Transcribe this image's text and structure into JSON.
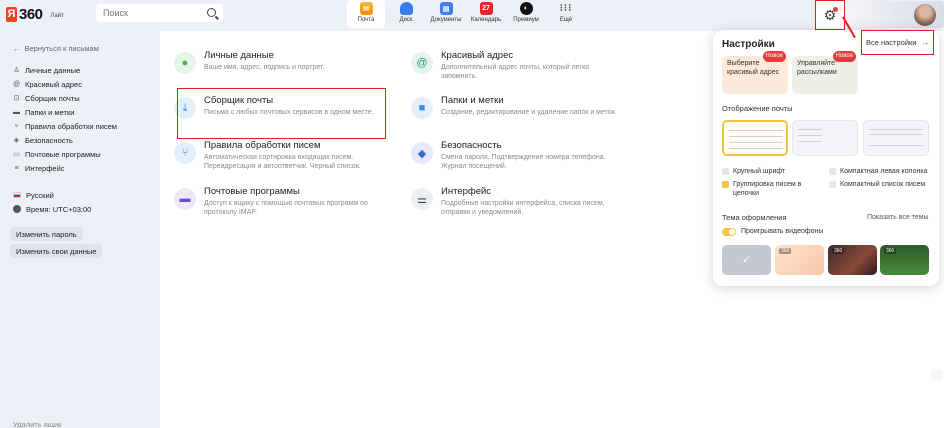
{
  "header": {
    "logo_ya": "Я",
    "logo_360": "360",
    "logo_lite": "Лайт",
    "search_placeholder": "Поиск",
    "apps": [
      {
        "label": "Почта",
        "icon": "mail-icon"
      },
      {
        "label": "Диск",
        "icon": "disk-icon"
      },
      {
        "label": "Документы",
        "icon": "documents-icon"
      },
      {
        "label": "Календарь",
        "icon": "calendar-icon",
        "badge": "27"
      },
      {
        "label": "Премиум",
        "icon": "premium-icon"
      },
      {
        "label": "Ещё",
        "icon": "more-icon"
      }
    ]
  },
  "sidebar": {
    "back": "Вернуться к письмам",
    "items": [
      "Личные данные",
      "Красивый адрес",
      "Сборщик почты",
      "Папки и метки",
      "Правила обработки писем",
      "Безопасность",
      "Почтовые программы",
      "Интерфейс"
    ],
    "language": "Русский",
    "timezone": "Время: UTC+03:00",
    "change_password": "Изменить пароль",
    "change_data": "Изменить свои данные",
    "delete_box": "Удалить ящик"
  },
  "cards": [
    {
      "title": "Личные данные",
      "desc": "Ваше имя, адрес, подпись и портрет.",
      "icon": "person-icon",
      "color": "#4caf50",
      "bg": "#e5f5e6"
    },
    {
      "title": "Красивый адрес",
      "desc": "Дополнительный адрес почты, который легко запомнить.",
      "icon": "at-icon",
      "color": "#2e9b6e",
      "bg": "#e3f4ec"
    },
    {
      "title": "Сборщик почты",
      "desc": "Письма с любых почтовых сервисов в одном месте.",
      "icon": "inbox-download-icon",
      "color": "#3a8de0",
      "bg": "#e4effb"
    },
    {
      "title": "Папки и метки",
      "desc": "Создание, редактирование и удаление папок и меток.",
      "icon": "folder-icon",
      "color": "#3a8de0",
      "bg": "#e4effb"
    },
    {
      "title": "Правила обработки писем",
      "desc": "Автоматическая сортировка входящих писем. Переадресация и автоответчик. Черный список.",
      "icon": "filter-icon",
      "color": "#3a8de0",
      "bg": "#e4effb"
    },
    {
      "title": "Безопасность",
      "desc": "Смена пароля. Подтверждение номера телефона. Журнал посещений.",
      "icon": "shield-icon",
      "color": "#3a6bd8",
      "bg": "#e4eafb"
    },
    {
      "title": "Почтовые программы",
      "desc": "Доступ к ящику с помощью почтовых программ по протоколу IMAP.",
      "icon": "mail-client-icon",
      "color": "#6a4bd0",
      "bg": "#ece7fb"
    },
    {
      "title": "Интерфейс",
      "desc": "Подробные настройки интерфейса, списка писем, отправки и уведомлений.",
      "icon": "sliders-icon",
      "color": "#444",
      "bg": "#eceff3"
    }
  ],
  "popup": {
    "title": "Настройки",
    "all_settings": "Все настройки",
    "promo1": {
      "text": "Выберите красивый адрес",
      "badge": "Новое"
    },
    "promo2": {
      "text": "Управляйте рассылками",
      "badge": "Новое"
    },
    "display_label": "Отображение почты",
    "options": [
      {
        "label": "Крупный шрифт",
        "checked": false
      },
      {
        "label": "Компактная левая колонка",
        "checked": false
      },
      {
        "label": "Группировка писем в цепочки",
        "checked": true
      },
      {
        "label": "Компактный список писем",
        "checked": false
      }
    ],
    "theme_label": "Тема оформления",
    "show_all_themes": "Показать все темы",
    "play_videos": "Проигрывать видеофоны",
    "theme_mark": "360"
  }
}
